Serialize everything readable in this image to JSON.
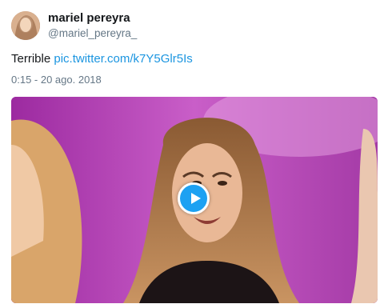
{
  "tweet": {
    "display_name": "mariel pereyra",
    "handle": "@mariel_pereyra_",
    "text": "Terrible",
    "link": "pic.twitter.com/k7Y5Glr5Is",
    "timestamp": "0:15 - 20 ago. 2018"
  },
  "media": {
    "type": "video",
    "play_icon": "play-icon"
  },
  "colors": {
    "link": "#1b95e0",
    "play_button": "#1da1f2",
    "secondary_text": "#657786"
  }
}
